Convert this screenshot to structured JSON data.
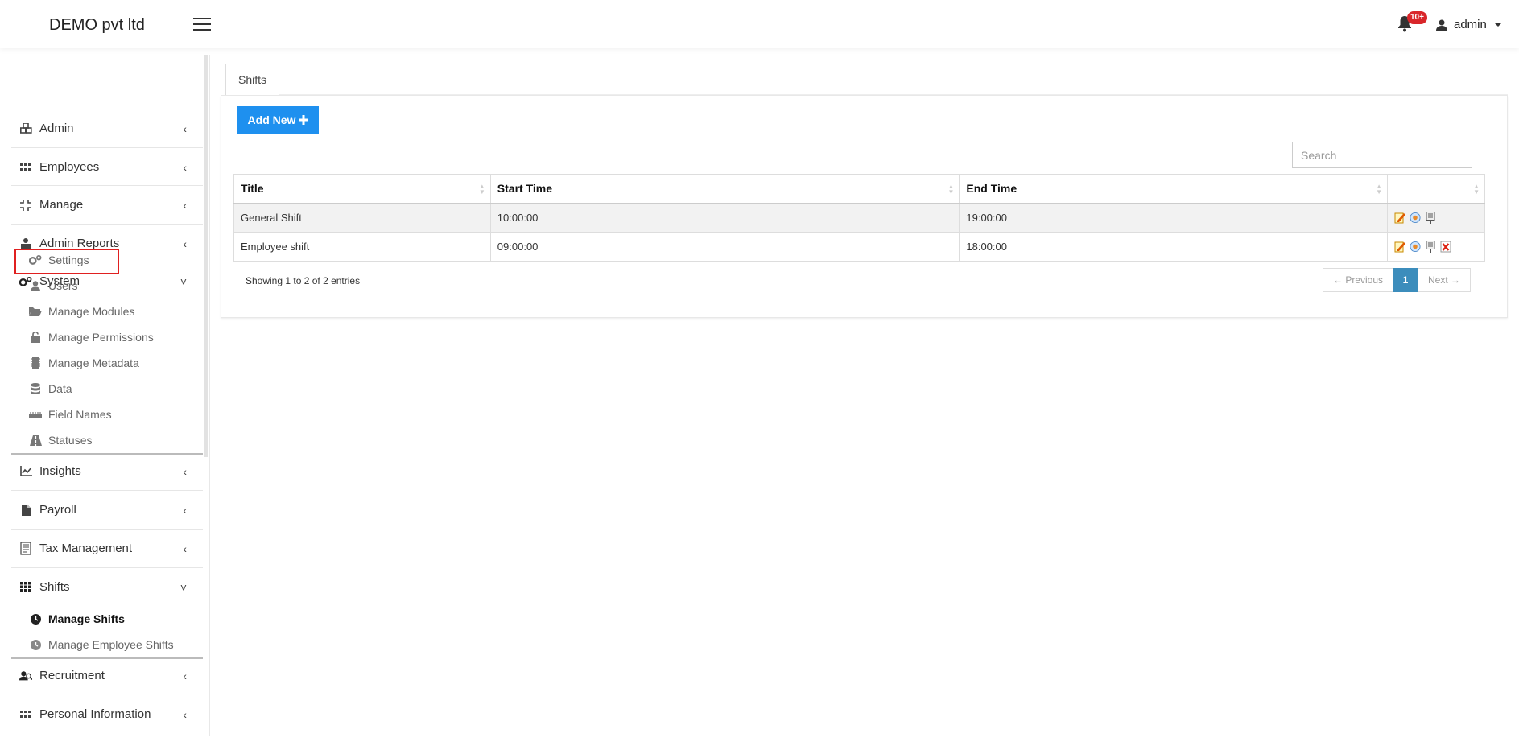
{
  "app": {
    "brand": "DEMO pvt ltd",
    "notification_count": "10+",
    "user_name": "admin"
  },
  "sidebar": {
    "items": [
      {
        "label": "Admin",
        "icon": "cubes-icon",
        "chevron": "‹"
      },
      {
        "label": "Employees",
        "icon": "grid-icon",
        "chevron": "‹"
      },
      {
        "label": "Manage",
        "icon": "compress-icon",
        "chevron": "‹"
      },
      {
        "label": "Admin Reports",
        "icon": "user-tie-icon",
        "chevron": "‹"
      },
      {
        "label": "System",
        "icon": "cogs-icon",
        "chevron": "˅"
      },
      {
        "label": "Insights",
        "icon": "line-chart-icon",
        "chevron": "‹"
      },
      {
        "label": "Payroll",
        "icon": "file-icon",
        "chevron": "‹"
      },
      {
        "label": "Tax Management",
        "icon": "receipt-icon",
        "chevron": "‹"
      },
      {
        "label": "Shifts",
        "icon": "th-icon",
        "chevron": "˅"
      },
      {
        "label": "Recruitment",
        "icon": "user-search-icon",
        "chevron": "‹"
      },
      {
        "label": "Personal Information",
        "icon": "grid-icon",
        "chevron": "‹"
      }
    ],
    "system_sub": [
      {
        "label": "Settings",
        "icon": "cogs-icon"
      },
      {
        "label": "Users",
        "icon": "user-icon"
      },
      {
        "label": "Manage Modules",
        "icon": "folder-open-icon"
      },
      {
        "label": "Manage Permissions",
        "icon": "unlock-icon"
      },
      {
        "label": "Manage Metadata",
        "icon": "microchip-icon"
      },
      {
        "label": "Data",
        "icon": "database-icon"
      },
      {
        "label": "Field Names",
        "icon": "ruler-icon"
      },
      {
        "label": "Statuses",
        "icon": "road-icon"
      }
    ],
    "shifts_sub": [
      {
        "label": "Manage Shifts",
        "icon": "clock-icon"
      },
      {
        "label": "Manage Employee Shifts",
        "icon": "clock-icon"
      }
    ]
  },
  "main": {
    "tab": "Shifts",
    "add_button": "Add New",
    "search_placeholder": "Search",
    "columns": [
      "Title",
      "Start Time",
      "End Time",
      ""
    ],
    "rows": [
      {
        "title": "General Shift",
        "start": "10:00:00",
        "end": "19:00:00"
      },
      {
        "title": "Employee shift",
        "start": "09:00:00",
        "end": "18:00:00"
      }
    ],
    "info": "Showing 1 to 2 of 2 entries",
    "pager": {
      "prev": "← Previous",
      "current": "1",
      "next": "Next →"
    }
  },
  "colors": {
    "primary": "#1e90ef",
    "pager_active": "#3c8dbc",
    "badge": "#d9262a",
    "highlight": "#e02020"
  }
}
